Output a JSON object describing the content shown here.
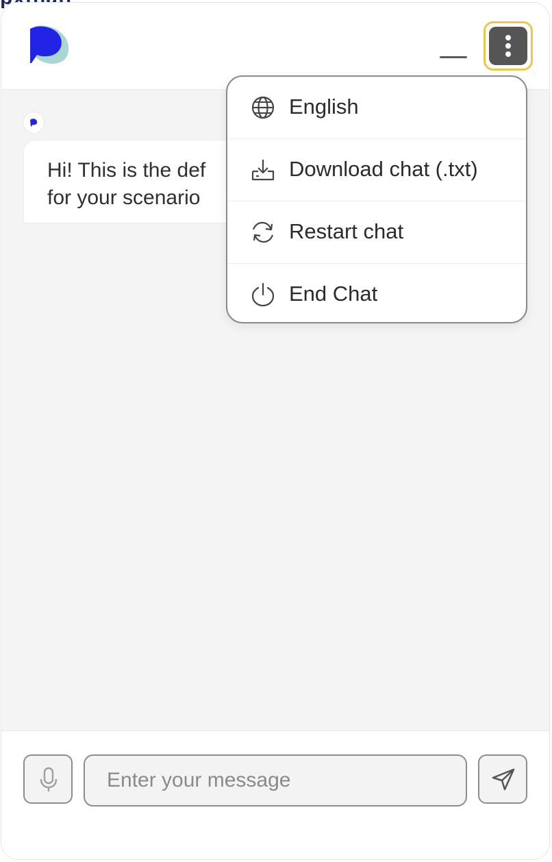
{
  "background": {
    "peek_text": "pxtnatr"
  },
  "header": {
    "logo_icon": "brand-logo-icon",
    "minimize_icon": "minimize-icon",
    "more_icon": "more-vertical-icon",
    "colors": {
      "logo_primary": "#2323e6",
      "logo_secondary": "#a9d6d2",
      "focus_ring": "#f0c64a",
      "more_button": "#555555"
    }
  },
  "conversation": {
    "avatar_icon": "bot-avatar-icon",
    "messages": [
      {
        "sender": "bot",
        "lines": [
          "Hi! This is the def",
          "for your scenario"
        ]
      }
    ]
  },
  "menu": {
    "items": [
      {
        "label": "English",
        "icon": "globe-icon"
      },
      {
        "label": "Download chat (.txt)",
        "icon": "download-icon"
      },
      {
        "label": "Restart chat",
        "icon": "refresh-icon"
      },
      {
        "label": "End Chat",
        "icon": "power-icon"
      }
    ]
  },
  "composer": {
    "placeholder": "Enter your message",
    "value": "",
    "mic_icon": "microphone-icon",
    "send_icon": "send-icon"
  }
}
